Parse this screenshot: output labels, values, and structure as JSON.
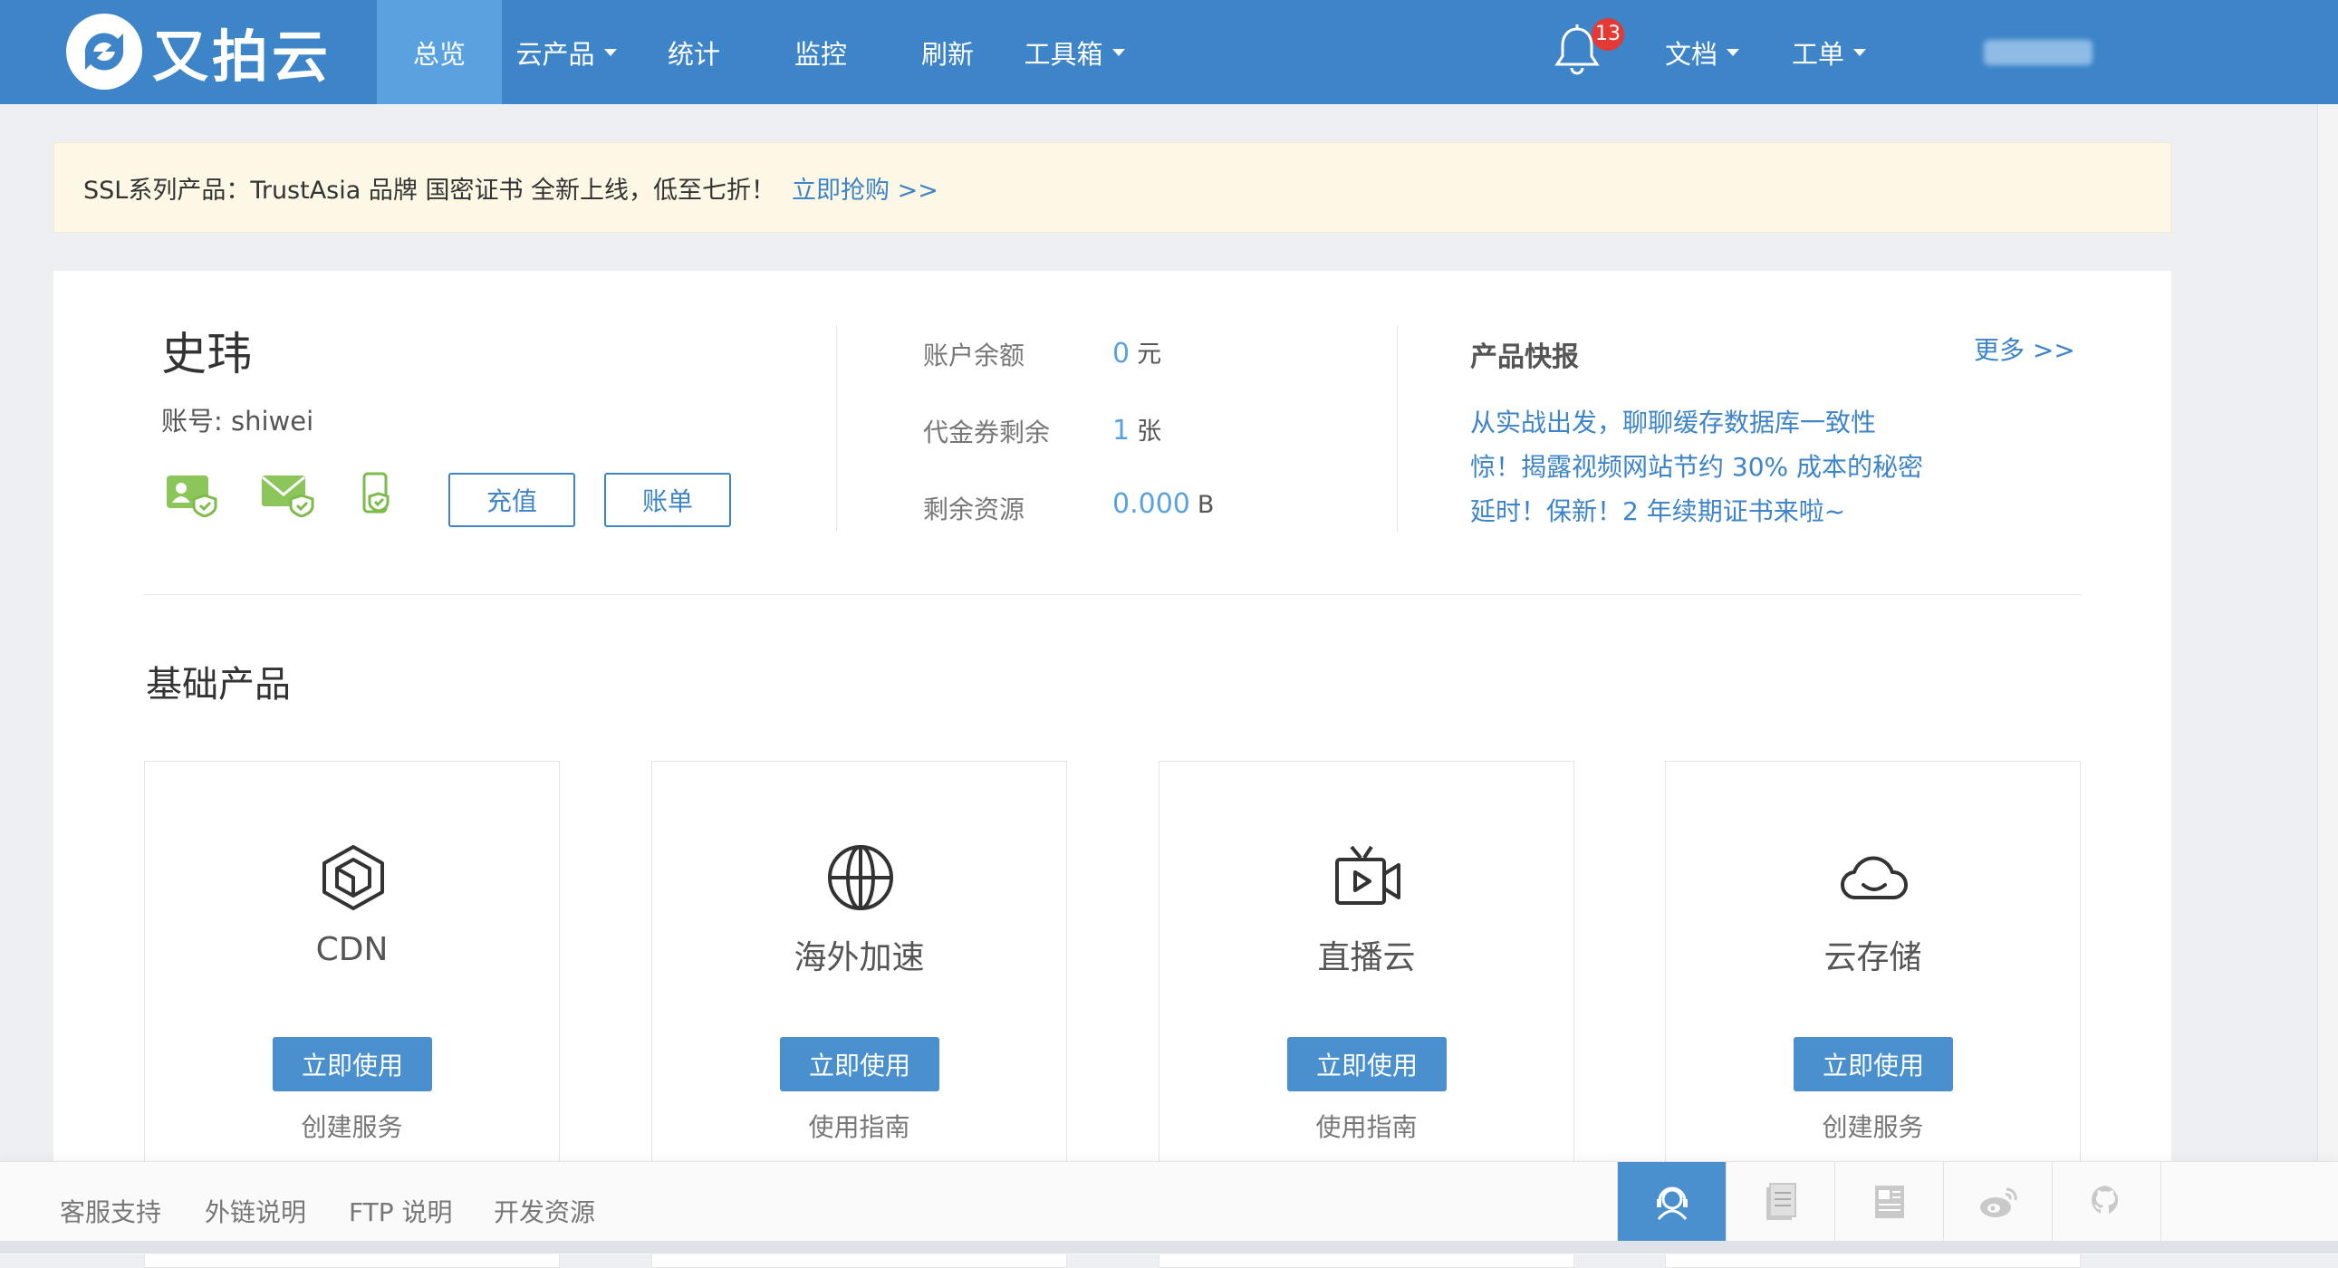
{
  "header": {
    "brand": "又拍云",
    "nav": [
      {
        "label": "总览",
        "active": true,
        "dropdown": false
      },
      {
        "label": "云产品",
        "active": false,
        "dropdown": true
      },
      {
        "label": "统计",
        "active": false,
        "dropdown": false
      },
      {
        "label": "监控",
        "active": false,
        "dropdown": false
      },
      {
        "label": "刷新",
        "active": false,
        "dropdown": false
      },
      {
        "label": "工具箱",
        "active": false,
        "dropdown": true
      }
    ],
    "notification_count": "13",
    "docs_label": "文档",
    "tickets_label": "工单"
  },
  "notice": {
    "text": "SSL系列产品：TrustAsia 品牌 国密证书 全新上线，低至七折！",
    "link": "立即抢购 >>"
  },
  "profile": {
    "name": "史玮",
    "account": "账号: shiwei",
    "recharge_label": "充值",
    "bill_label": "账单"
  },
  "stats": [
    {
      "label": "账户余额",
      "value": "0",
      "unit": "元"
    },
    {
      "label": "代金券剩余",
      "value": "1",
      "unit": "张"
    },
    {
      "label": "剩余资源",
      "value": "0.000",
      "unit": "B"
    }
  ],
  "news": {
    "title": "产品快报",
    "more": "更多 >>",
    "items": [
      "从实战出发，聊聊缓存数据库一致性",
      "惊！揭露视频网站节约 30% 成本的秘密",
      "延时！保新！2 年续期证书来啦~"
    ]
  },
  "section_title": "基础产品",
  "products": [
    {
      "name": "CDN",
      "icon": "cdn-cube-icon",
      "action": "立即使用",
      "link": "创建服务"
    },
    {
      "name": "海外加速",
      "icon": "globe-icon",
      "action": "立即使用",
      "link": "使用指南"
    },
    {
      "name": "直播云",
      "icon": "tv-live-icon",
      "action": "立即使用",
      "link": "使用指南"
    },
    {
      "name": "云存储",
      "icon": "cloud-icon",
      "action": "立即使用",
      "link": "创建服务"
    }
  ],
  "footer": {
    "links": [
      "客服支持",
      "外链说明",
      "FTP 说明",
      "开发资源"
    ],
    "icons": [
      "support-agent-icon",
      "document-icon",
      "news-icon",
      "weibo-icon",
      "github-icon"
    ]
  },
  "colors": {
    "primary": "#3d84c8",
    "nav_active": "#5aa1e0",
    "verified_green": "#7dbb4a",
    "badge_red": "#e53935",
    "notice_bg": "#fdf7e5"
  }
}
